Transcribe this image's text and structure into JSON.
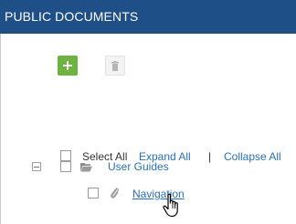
{
  "header": {
    "title": "PUBLIC DOCUMENTS"
  },
  "toolbar": {
    "add_icon": "plus-icon",
    "delete_icon": "trash-icon"
  },
  "controls": {
    "select_all": "Select All",
    "expand_all": "Expand All",
    "separator": "|",
    "collapse_all": "Collapse All"
  },
  "tree": {
    "folder": {
      "label": "User Guides",
      "icon": "folder-open-icon",
      "toggle_icon": "collapse-minus-icon"
    },
    "child": {
      "label": "Navigation",
      "icon": "paperclip-icon"
    }
  },
  "cursor": {
    "icon": "hand-pointer-cursor-icon"
  },
  "colors": {
    "header_bg": "#1e4f87",
    "add_button": "#6cb33f",
    "link": "#2a6fb5"
  }
}
